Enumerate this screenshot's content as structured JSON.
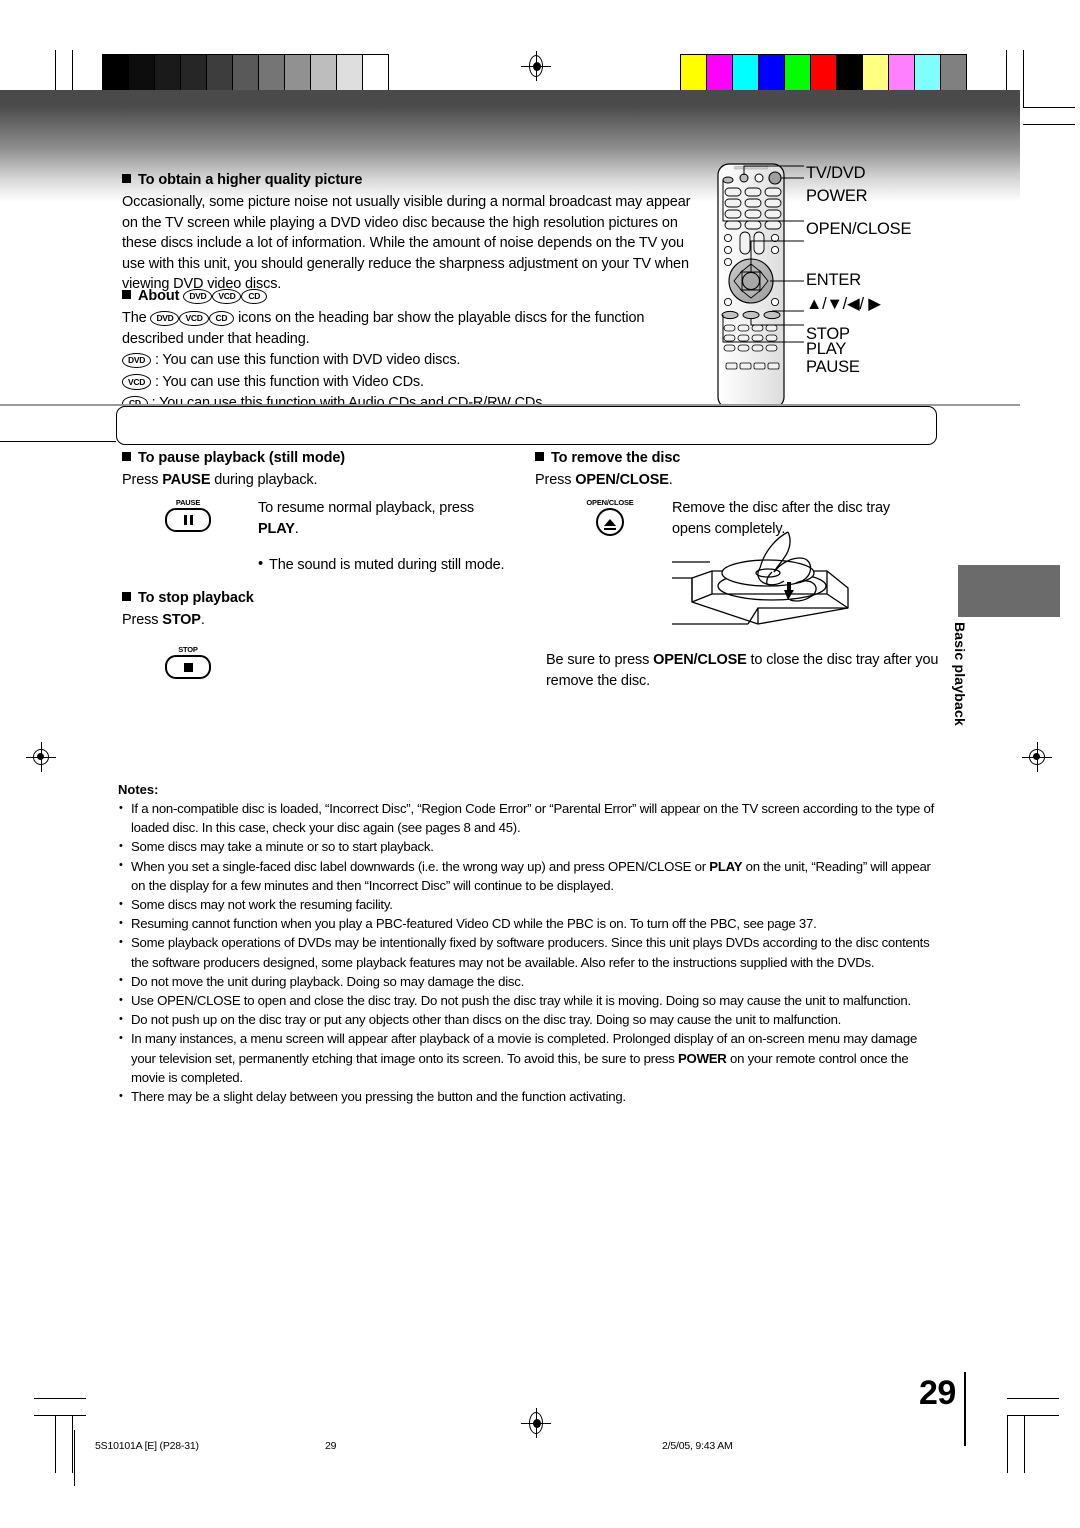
{
  "document": {
    "page_number": "29",
    "side_tab_label": "Basic playback",
    "footer": {
      "doc_code": "5S10101A [E] (P28-31)",
      "page": "29",
      "timestamp": "2/5/05, 9:43 AM"
    }
  },
  "section_quality": {
    "heading": "To obtain a higher quality picture",
    "paragraph": "Occasionally, some picture noise not usually visible during a normal broadcast may appear on the TV screen while playing a DVD video disc because the high resolution pictures on these discs include a lot of information. While the amount of noise depends on the TV you use with this unit, you should generally reduce the sharpness adjustment on your TV when viewing DVD video discs."
  },
  "section_about": {
    "heading": "About",
    "line1_pre": "The",
    "line1_post": "icons on the heading bar show the playable discs for the function described under that heading.",
    "items": [
      {
        "icon": "DVD",
        "text": ": You can use this function with DVD video discs."
      },
      {
        "icon": "VCD",
        "text": ": You can use this function with Video CDs."
      },
      {
        "icon": "CD",
        "text": ": You can use this function with Audio CDs and CD-R/RW CDs."
      }
    ]
  },
  "section_pause": {
    "heading": "To pause playback (still mode)",
    "instruction_pre": "Press ",
    "instruction_key": "PAUSE",
    "instruction_post": " during playback.",
    "button_label": "PAUSE",
    "resume_pre": "To resume normal playback, press ",
    "resume_key": "PLAY",
    "resume_post": ".",
    "bullet": "The sound is muted during still mode."
  },
  "section_stop": {
    "heading": "To stop playback",
    "instruction_pre": "Press ",
    "instruction_key": "STOP",
    "instruction_post": ".",
    "button_label": "STOP"
  },
  "section_remove": {
    "heading": "To remove the disc",
    "instruction_pre": "Press ",
    "instruction_key": "OPEN/CLOSE",
    "instruction_post": ".",
    "button_label": "OPEN/CLOSE",
    "body": "Remove the disc after the disc tray opens completely.",
    "closing_pre": "Be sure to press ",
    "closing_key": "OPEN/CLOSE",
    "closing_post": " to close the disc tray after you remove the disc."
  },
  "remote_callouts": [
    "TV/DVD",
    "POWER",
    "OPEN/CLOSE",
    "ENTER",
    "▲/▼/◀/ ▶",
    "STOP",
    "PLAY",
    "PAUSE"
  ],
  "notes": {
    "title": "Notes:",
    "items": [
      "If a non-compatible disc is loaded, “Incorrect Disc”, “Region Code Error” or “Parental Error” will appear on the TV screen according to the type of loaded disc. In this case, check your disc again (see pages 8 and 45).",
      "Some discs may take a minute or so to start playback.",
      "When you set a single-faced disc label downwards (i.e. the wrong way up) and press OPEN/CLOSE or PLAY on the unit, “Reading” will appear on the display for a few minutes and then “Incorrect Disc” will continue to be displayed.",
      "Some discs may not work the resuming facility.",
      "Resuming cannot function when you play a PBC-featured Video CD while the PBC is on. To turn off the PBC, see page 37.",
      "Some playback operations of DVDs may be intentionally fixed by software producers. Since this unit plays DVDs according to the disc contents the software producers designed, some playback features may not be available. Also refer to the instructions supplied with the DVDs.",
      "Do not move the unit during playback. Doing so may damage the disc.",
      "Use OPEN/CLOSE to open and close the disc tray. Do not push the disc tray while it is moving. Doing so may cause the unit to malfunction.",
      "Do not push up on the disc tray or put any objects other than discs on the disc tray. Doing so may cause the unit to malfunction.",
      "In many instances, a menu screen will appear after playback of a movie is completed. Prolonged display of an on-screen menu may damage your television set, permanently etching that image onto its screen. To avoid this, be sure to press POWER on your remote control once the movie is completed.",
      "There may be a slight delay between you pressing the button and the function activating."
    ]
  },
  "calibration": {
    "grayscale": [
      "#000000",
      "#0d0d0d",
      "#1a1a1a",
      "#262626",
      "#3d3d3d",
      "#595959",
      "#757575",
      "#919191",
      "#bdbdbd",
      "#dedede",
      "#ffffff"
    ],
    "colors": [
      "#ffff00",
      "#ff00ff",
      "#00ffff",
      "#0000ff",
      "#00ff00",
      "#ff0000",
      "#000000",
      "#ffff80",
      "#ff80ff",
      "#80ffff",
      "#808080"
    ]
  }
}
